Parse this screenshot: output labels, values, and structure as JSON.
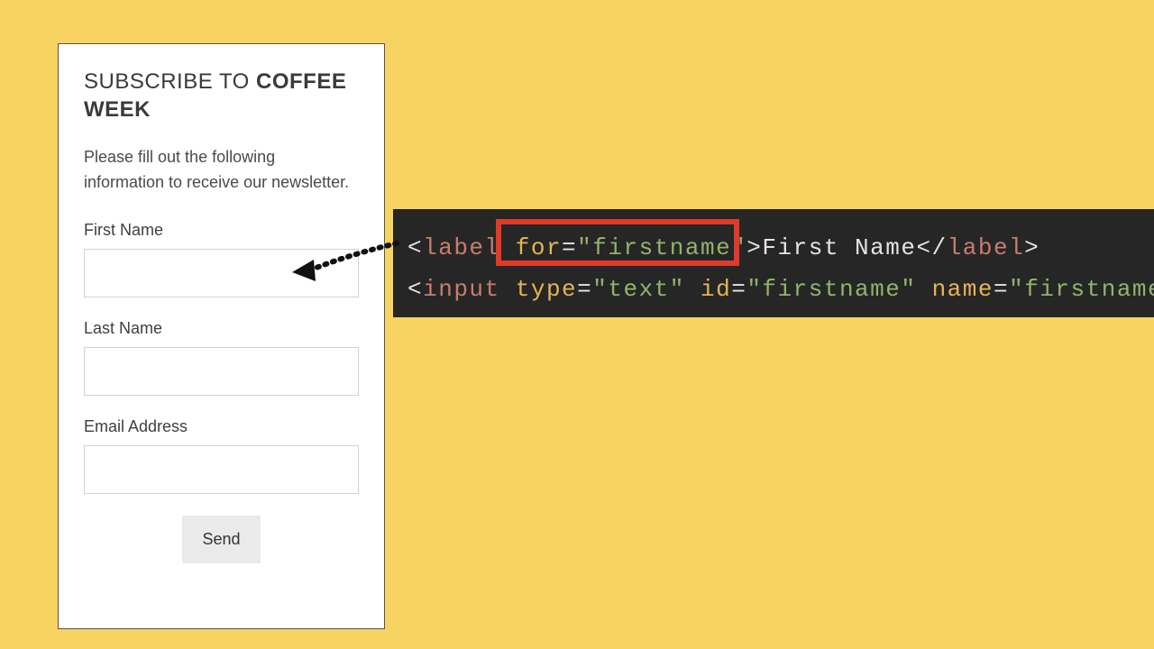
{
  "form": {
    "title_prefix": "SUBSCRIBE TO ",
    "title_bold": "COFFEE WEEK",
    "description": "Please fill out the following information to receive our newsletter.",
    "first_name_label": "First Name",
    "last_name_label": "Last Name",
    "email_label": "Email Address",
    "first_name_value": "",
    "last_name_value": "",
    "email_value": "",
    "send_label": "Send"
  },
  "code": {
    "line1": {
      "open_bracket": "<",
      "tag": "label",
      "space1": " ",
      "attr": "for",
      "eq": "=",
      "str": "\"firstname\"",
      "close_bracket": ">",
      "text": "First Name",
      "open_bracket2": "</",
      "tag2": "label",
      "close_bracket2": ">"
    },
    "line2": {
      "open_bracket": "<",
      "tag": "input",
      "space1": " ",
      "attr1": "type",
      "eq1": "=",
      "str1": "\"text\"",
      "space2": " ",
      "attr2": "id",
      "eq2": "=",
      "str2": "\"firstname\"",
      "space3": " ",
      "attr3": "name",
      "eq3": "=",
      "str3": "\"firstname\"",
      "close_bracket": ">"
    }
  }
}
